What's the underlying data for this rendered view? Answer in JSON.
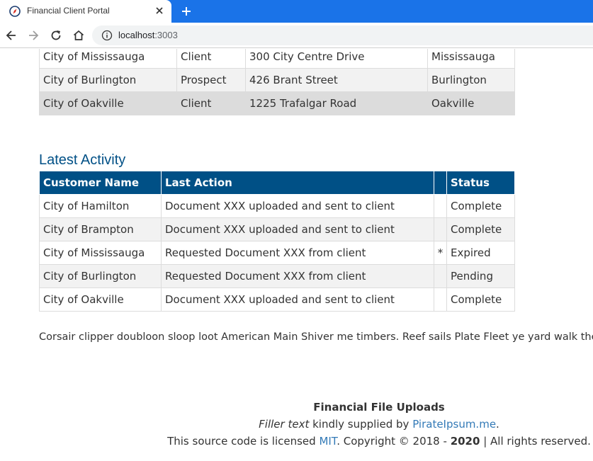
{
  "browser": {
    "tab_title": "Financial Client Portal",
    "url_host": "localhost",
    "url_port": ":3003"
  },
  "clients_table": {
    "rows": [
      {
        "name": "City of Mississauga",
        "type": "Client",
        "address": "300 City Centre Drive",
        "city": "Mississauga"
      },
      {
        "name": "City of Burlington",
        "type": "Prospect",
        "address": "426 Brant Street",
        "city": "Burlington"
      },
      {
        "name": "City of Oakville",
        "type": "Client",
        "address": "1225 Trafalgar Road",
        "city": "Oakville"
      }
    ]
  },
  "activity": {
    "title": "Latest Activity",
    "headers": [
      "Customer Name",
      "Last Action",
      "",
      "Status"
    ],
    "rows": [
      {
        "customer": "City of Hamilton",
        "action": "Document XXX uploaded and sent to client",
        "mark": "",
        "status": "Complete"
      },
      {
        "customer": "City of Brampton",
        "action": "Document XXX uploaded and sent to client",
        "mark": "",
        "status": "Complete"
      },
      {
        "customer": "City of Mississauga",
        "action": "Requested Document XXX from client",
        "mark": "*",
        "status": "Expired"
      },
      {
        "customer": "City of Burlington",
        "action": "Requested Document XXX from client",
        "mark": "",
        "status": "Pending"
      },
      {
        "customer": "City of Oakville",
        "action": "Document XXX uploaded and sent to client",
        "mark": "",
        "status": "Complete"
      }
    ]
  },
  "filler_paragraph": "Corsair clipper doubloon sloop loot American Main Shiver me timbers. Reef sails Plate Fleet ye yard walk the pla",
  "footer": {
    "title": "Financial File Uploads",
    "line2_em": "Filler text",
    "line2_mid": " kindly supplied by ",
    "line2_link": "PirateIpsum.me",
    "line2_end": ".",
    "line3_start": "This source code is licensed ",
    "line3_link": "MIT",
    "line3_mid": ". Copyright © 2018 - ",
    "line3_year": "2020",
    "line3_end": " | All rights reserved."
  }
}
